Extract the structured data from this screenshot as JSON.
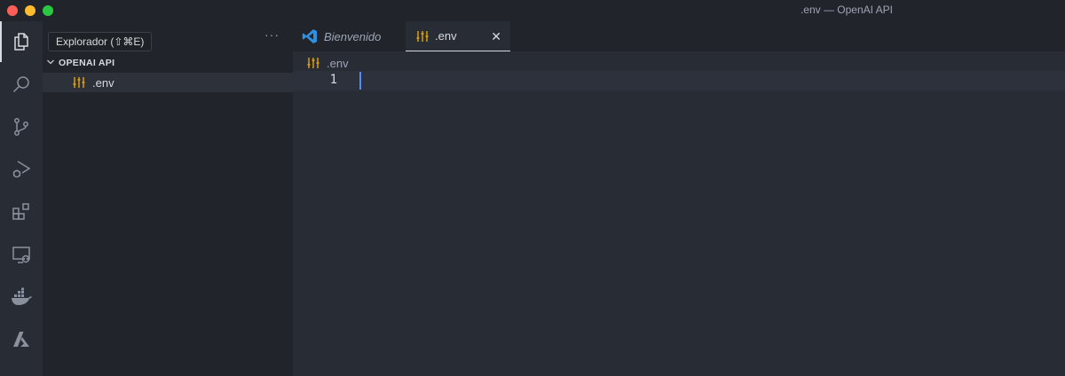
{
  "window": {
    "title": ".env — OpenAI API"
  },
  "activity_bar": {
    "items": [
      {
        "icon": "files-icon",
        "name": "explorer"
      },
      {
        "icon": "search-icon",
        "name": "search"
      },
      {
        "icon": "source-control-icon",
        "name": "source-control"
      },
      {
        "icon": "run-debug-icon",
        "name": "run-debug"
      },
      {
        "icon": "extensions-icon",
        "name": "extensions"
      },
      {
        "icon": "remote-explorer-icon",
        "name": "remote-explorer"
      },
      {
        "icon": "docker-icon",
        "name": "docker"
      },
      {
        "icon": "azure-icon",
        "name": "azure"
      }
    ]
  },
  "tooltip": {
    "text": "Explorador (⇧⌘E)"
  },
  "sidebar": {
    "more_label": "···",
    "folder": {
      "name": "OPENAI API",
      "expanded": true
    },
    "files": [
      {
        "name": ".env",
        "icon": "settings-file-icon"
      }
    ]
  },
  "editor": {
    "tabs": [
      {
        "label": "Bienvenido",
        "icon": "vscode-icon",
        "active": false
      },
      {
        "label": ".env",
        "icon": "settings-file-icon",
        "active": true,
        "close": "✕"
      }
    ],
    "breadcrumb": {
      "label": ".env"
    },
    "lines": [
      {
        "number": "1",
        "text": ""
      }
    ]
  },
  "colors": {
    "accent_blue": "#528bff",
    "file_icon_yellow": "#e5a50a",
    "vscode_blue": "#2f8fe0"
  }
}
